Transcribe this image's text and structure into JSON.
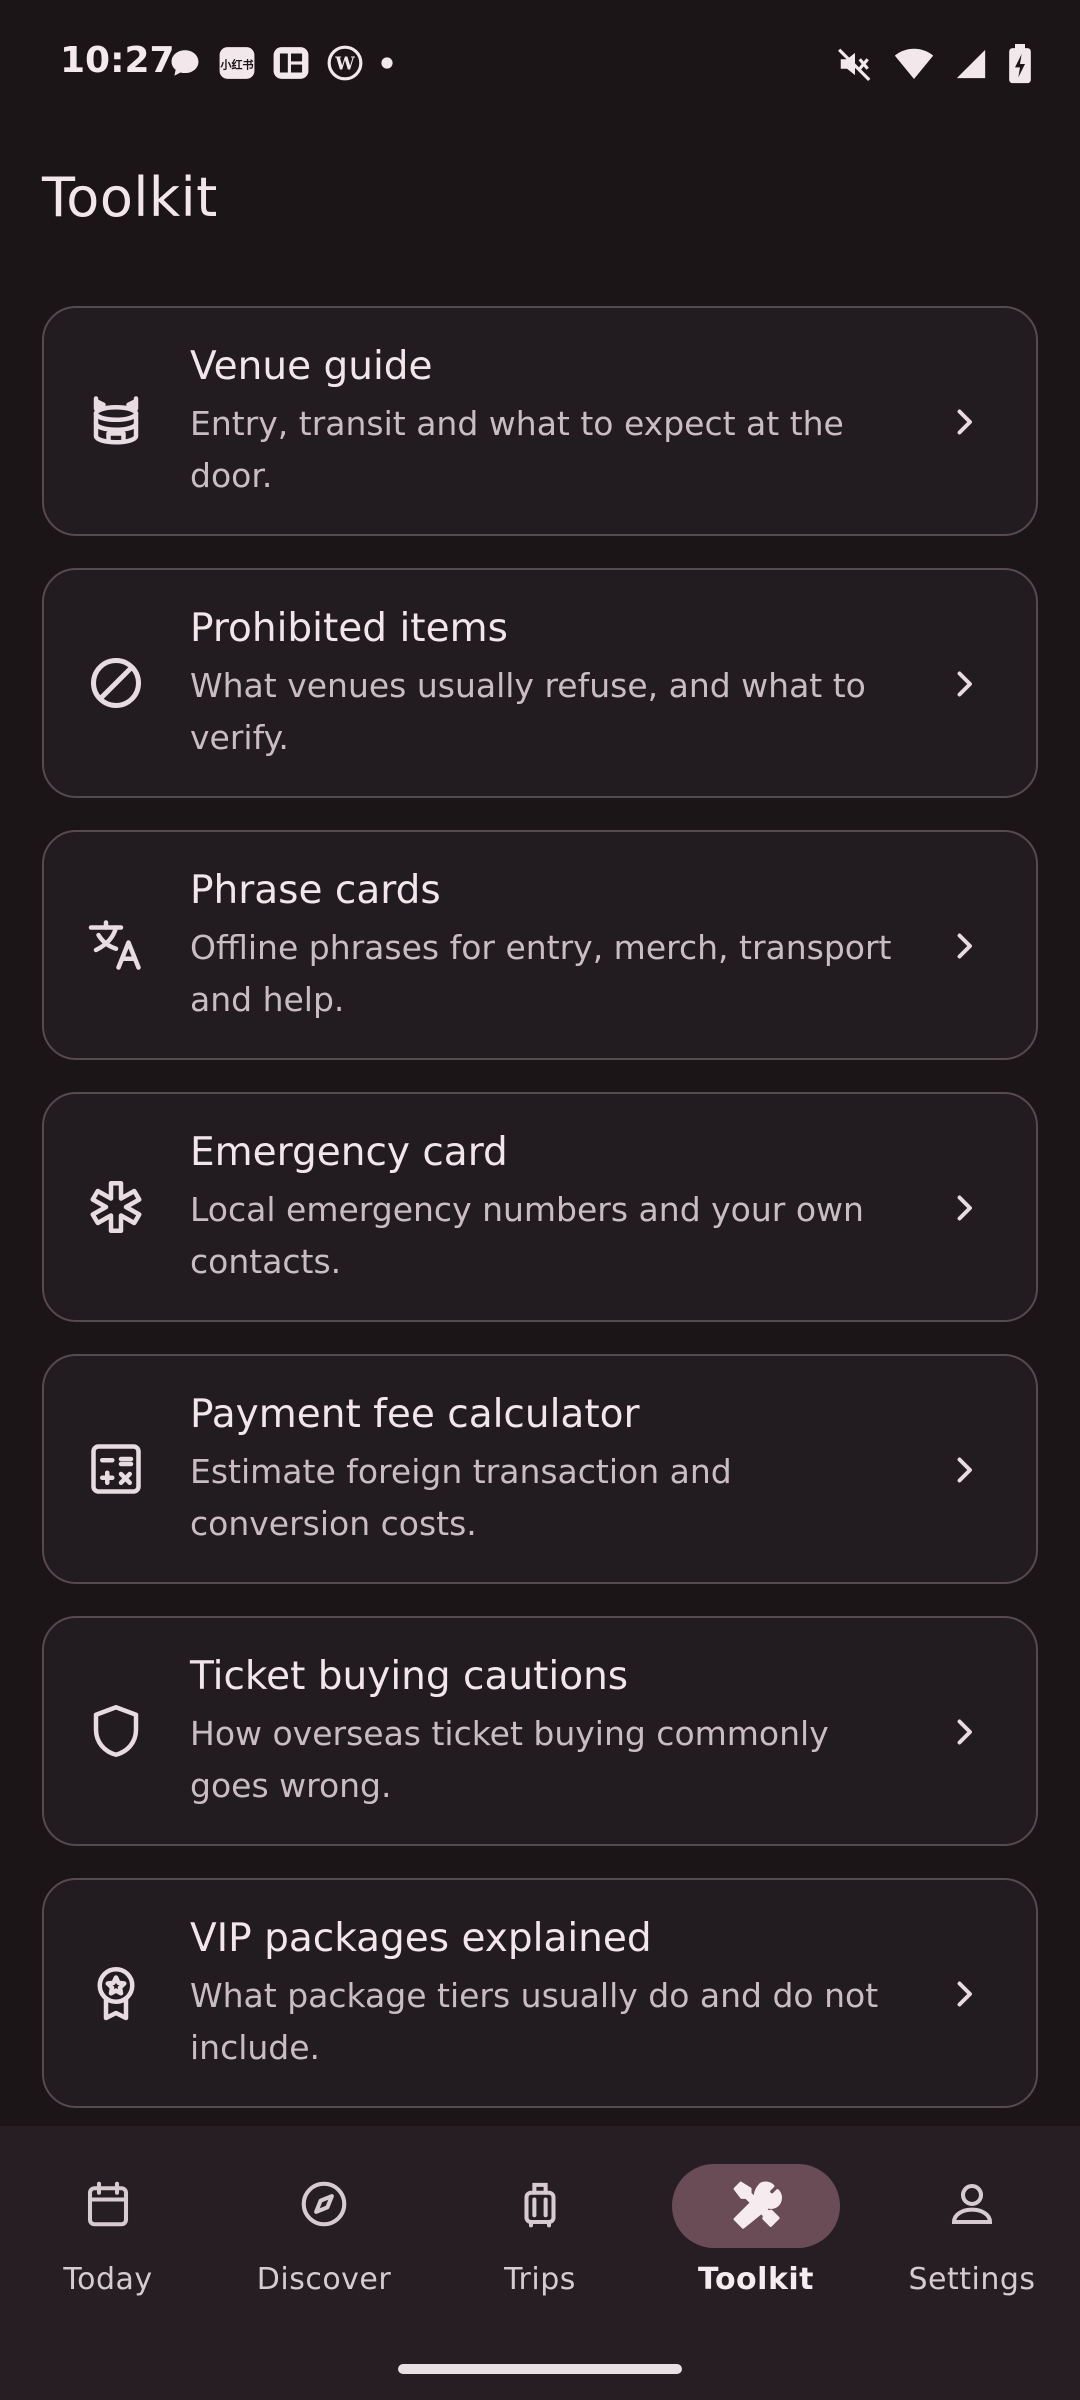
{
  "status_bar": {
    "time": "10:27",
    "left_icons": [
      "chat-bubble-icon",
      "xiaohongshu-icon",
      "news-app-icon",
      "wordpress-icon",
      "dot-icon"
    ],
    "right_icons": [
      "mute-icon",
      "wifi-icon",
      "signal-icon",
      "battery-charging-icon"
    ]
  },
  "header": {
    "title": "Toolkit"
  },
  "tools": [
    {
      "icon": "stadium-icon",
      "title": "Venue guide",
      "desc": "Entry, transit and what to expect at the door."
    },
    {
      "icon": "prohibited-icon",
      "title": "Prohibited items",
      "desc": "What venues usually refuse, and what to verify."
    },
    {
      "icon": "translate-icon",
      "title": "Phrase cards",
      "desc": "Offline phrases for entry, merch, transport and help."
    },
    {
      "icon": "emergency-icon",
      "title": "Emergency card",
      "desc": "Local emergency numbers and your own contacts."
    },
    {
      "icon": "calculator-icon",
      "title": "Payment fee calculator",
      "desc": "Estimate foreign transaction and conversion costs."
    },
    {
      "icon": "shield-icon",
      "title": "Ticket buying cautions",
      "desc": "How overseas ticket buying commonly goes wrong."
    },
    {
      "icon": "award-icon",
      "title": "VIP packages explained",
      "desc": "What package tiers usually do and do not include."
    }
  ],
  "bottom_nav": {
    "items": [
      {
        "label": "Today",
        "icon": "calendar-icon"
      },
      {
        "label": "Discover",
        "icon": "compass-icon"
      },
      {
        "label": "Trips",
        "icon": "luggage-icon"
      },
      {
        "label": "Toolkit",
        "icon": "tools-icon",
        "active": true
      },
      {
        "label": "Settings",
        "icon": "person-icon"
      }
    ]
  },
  "colors": {
    "background": "#1b1518",
    "card_border": "#564a4f",
    "active_pill": "#6a4c56"
  }
}
